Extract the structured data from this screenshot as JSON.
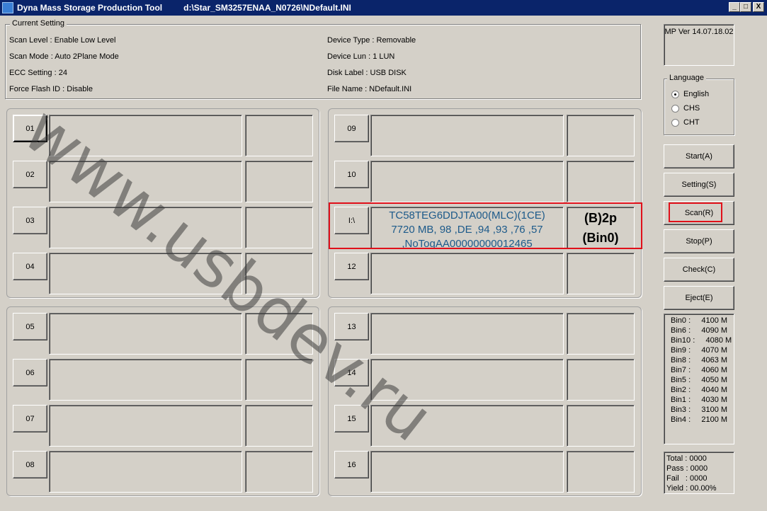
{
  "window": {
    "app_name": "Dyna Mass Storage Production Tool",
    "path": "d:\\Star_SM3257ENAA_N0726\\NDefault.INI",
    "minimize": "_",
    "restore": "□",
    "close": "X"
  },
  "current_setting": {
    "legend": "Current Setting",
    "left": [
      "Scan Level : Enable Low Level",
      "Scan Mode : Auto 2Plane Mode",
      "ECC Setting : 24",
      "Force Flash ID : Disable"
    ],
    "right": [
      "Device Type : Removable",
      "Device Lun : 1 LUN",
      "Disk Label : USB DISK",
      "File Name : NDefault.INI"
    ]
  },
  "version": "MP Ver 14.07.18.02",
  "language": {
    "legend": "Language",
    "options": [
      "English",
      "CHS",
      "CHT"
    ],
    "selected": "English"
  },
  "buttons": {
    "start": "Start(A)",
    "setting": "Setting(S)",
    "scan": "Scan(R)",
    "stop": "Stop(P)",
    "check": "Check(C)",
    "eject": "Eject(E)"
  },
  "ports": {
    "p01": "01",
    "p02": "02",
    "p03": "03",
    "p04": "04",
    "p05": "05",
    "p06": "06",
    "p07": "07",
    "p08": "08",
    "p09": "09",
    "p10": "10",
    "p11": "I:\\",
    "p12": "12",
    "p13": "13",
    "p14": "14",
    "p15": "15",
    "p16": "16"
  },
  "active_port": {
    "line1": "TC58TEG6DDJTA00(MLC)(1CE)",
    "line2": "7720 MB, 98 ,DE ,94 ,93 ,76 ,57",
    "line3": ",NoTogAA00000000012465",
    "bin_line1": "(B)2p",
    "bin_line2": "(Bin0)"
  },
  "bins": [
    "Bin0 :     4100 M",
    "Bin6 :     4090 M",
    "Bin10 :     4080 M",
    "Bin9 :     4070 M",
    "Bin8 :     4063 M",
    "Bin7 :     4060 M",
    "Bin5 :     4050 M",
    "Bin2 :     4040 M",
    "Bin1 :     4030 M",
    "Bin3 :     3100 M",
    "Bin4 :     2100 M"
  ],
  "stats": {
    "total": "Total : 0000",
    "pass": "Pass : 0000",
    "fail": "Fail   : 0000",
    "yield": "Yield : 00.00%"
  },
  "watermark": "www.usbdev.ru"
}
